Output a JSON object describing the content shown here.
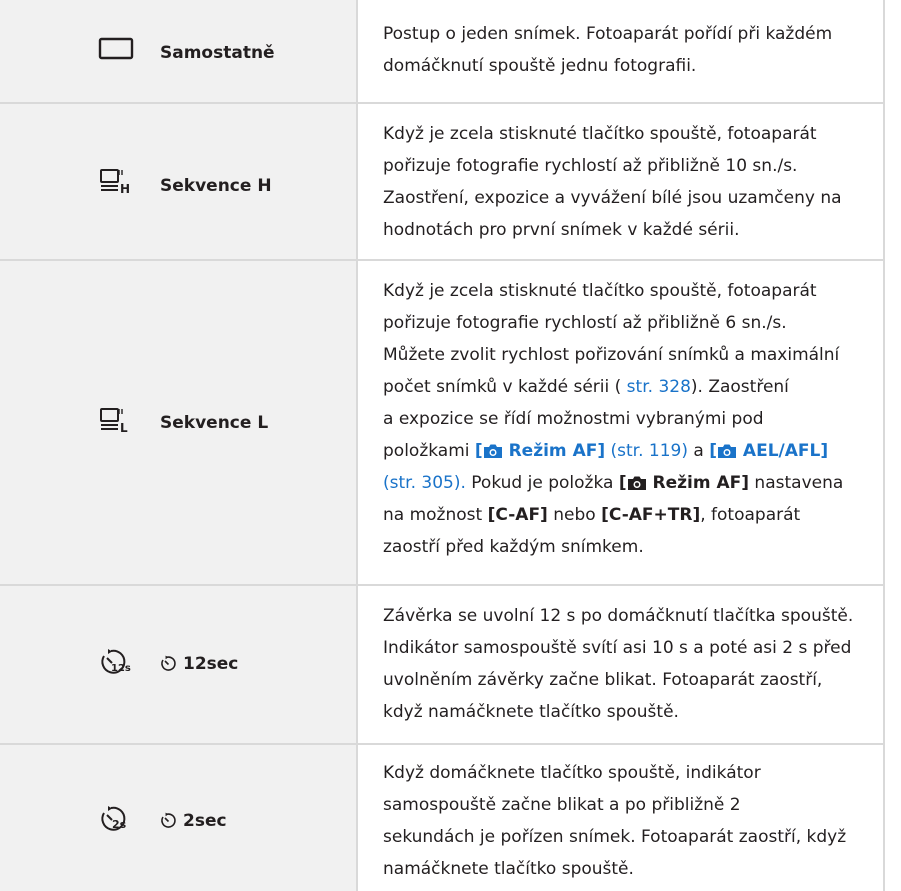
{
  "rows": [
    {
      "name": "Samostatně",
      "icon": "single-frame-icon",
      "desc": [
        "Postup o jeden snímek. Fotoaparát pořídí při každém",
        "domáčknutí spouště jednu fotografii."
      ]
    },
    {
      "name": "Sekvence H",
      "icon": "sequential-high-icon",
      "desc": [
        "Když je zcela stisknuté tlačítko spouště, fotoaparát",
        "pořizuje fotografie rychlostí až přibližně 10 sn./s.",
        "Zaostření, expozice a vyvážení bílé jsou uzamčeny na",
        "hodnotách pro první snímek v každé sérii."
      ]
    },
    {
      "name": "Sekvence L",
      "icon": "sequential-low-icon",
      "desc": [
        "Když je zcela stisknuté tlačítko spouště, fotoaparát",
        "pořizuje fotografie rychlostí až přibližně 6 sn./s.",
        "Můžete zvolit rychlost pořizování snímků a maximální"
      ],
      "l4a": "počet snímků v každé sérii (",
      "l4link": " str. 328",
      "l4b": "). Zaostření",
      "l5": "a expozice se řídí možnostmi vybranými pod",
      "l6a": "položkami ",
      "l6m1": "[",
      "l6m1b": " Režim AF]",
      "l6p1": " (str. 119)",
      "l6c": " a ",
      "l6m2": "[",
      "l6m2b": " AEL/AFL]",
      "l7p": "(str. 305).",
      "l7a": " Pokud je položka ",
      "l7m": "[",
      "l7mb": " Režim AF]",
      "l7b": " nastavena",
      "l8a": "na možnost ",
      "l8m1": "[C-AF]",
      "l8b": " nebo ",
      "l8m2": "[C-AF+TR]",
      "l8c": ", fotoaparát",
      "l9": "zaostří před každým snímkem."
    },
    {
      "name": "12sec",
      "icon": "self-timer-12s-icon",
      "desc": [
        "Závěrka se uvolní 12 s po domáčknutí tlačítka spouště.",
        "Indikátor samospouště svítí asi 10 s a poté asi 2 s před",
        "uvolněním závěrky začne blikat. Fotoaparát zaostří,",
        "když namáčknete tlačítko spouště."
      ]
    },
    {
      "name": "2sec",
      "icon": "self-timer-2s-icon",
      "desc": [
        "Když domáčknete tlačítko spouště, indikátor",
        "samospouště začne blikat a po přibližně 2",
        "sekundách je pořízen snímek. Fotoaparát zaostří, když",
        "namáčknete tlačítko spouště."
      ]
    }
  ],
  "colors": {
    "cell_bg": "#f1f1f1",
    "rule": "#d9d9d9",
    "text": "#231f20",
    "link": "#1a73c9"
  }
}
